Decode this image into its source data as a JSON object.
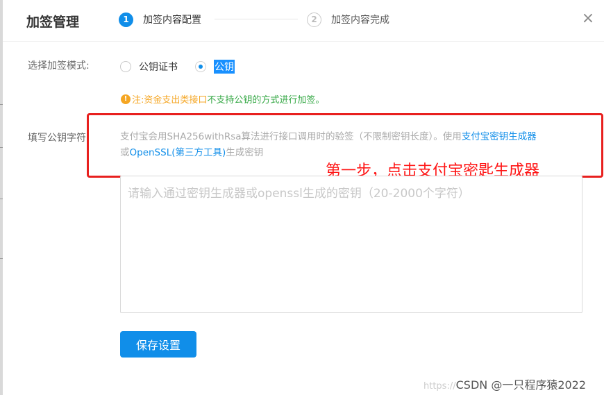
{
  "dialog": {
    "title": "加签管理",
    "close_icon": "×"
  },
  "steps": [
    {
      "number": "1",
      "label": "加签内容配置"
    },
    {
      "number": "2",
      "label": "加签内容完成"
    }
  ],
  "mode": {
    "label": "选择加签模式:",
    "options": [
      {
        "label": "公钥证书",
        "selected": false
      },
      {
        "label": "公钥",
        "selected": true
      }
    ]
  },
  "warning": {
    "icon": "!",
    "prefix": "注:",
    "part1": "资金支出类接口",
    "part2": "不支持公钥的方式进行加签。"
  },
  "key_field": {
    "label": "填写公钥字符:",
    "desc_part1": "支付宝会用SHA256withRsa算法进行接口调用时的验签（不限制密钥长度）。使用",
    "link1": "支付宝密钥生成器",
    "desc_part2": "或",
    "link2": "OpenSSL(第三方工具)",
    "desc_part3": "生成密钥",
    "placeholder": "请输入通过密钥生成器或openssl生成的密钥（20-2000个字符）"
  },
  "annotation": {
    "text": "第一步，点击支付宝密匙生成器",
    "color": "#e8201e"
  },
  "save_button": "保存设置",
  "watermark": {
    "faint": "https://",
    "text": "CSDN @一只程序猿2022"
  },
  "colors": {
    "primary": "#108ee9",
    "warning": "#f5a623",
    "annotation": "#e8201e"
  }
}
